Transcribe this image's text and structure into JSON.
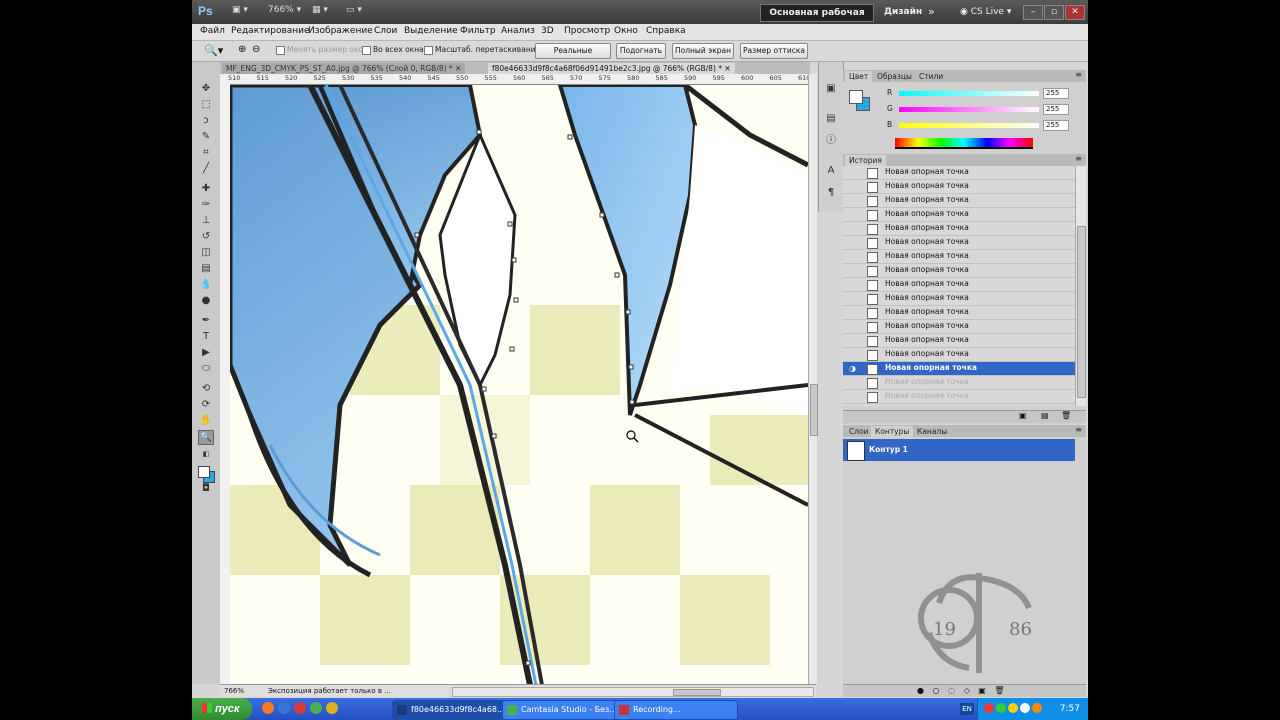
{
  "appbar": {
    "logo": "Ps",
    "zoom": "766%",
    "workspace_button": "Основная рабочая среда",
    "workspace_design": "Дизайн",
    "workspace_more": "»",
    "cslive": "CS Live"
  },
  "menu": [
    "Файл",
    "Редактирование",
    "Изображение",
    "Слои",
    "Выделение",
    "Фильтр",
    "Анализ",
    "3D",
    "Просмотр",
    "Окно",
    "Справка"
  ],
  "options": {
    "resize_windows": "Менять размер окон",
    "all_windows": "Во всех окнах",
    "scrubby_zoom": "Масштаб. перетаскиванием",
    "actual_pixels": "Реальные пикселы",
    "fit_screen": "Подогнать",
    "fill_screen": "Полный экран",
    "print_size": "Размер оттиска"
  },
  "document": {
    "tab_inactive": "MF_ENG_3D_CMYK_PS_ST_A0.jpg @ 766% (Слой 0, RGB/8) *",
    "tab_active": "f80e46633d9f8c4a68f06d91491be2c3.jpg @ 766% (RGB/8) *",
    "ruler_ticks": [
      "510",
      "515",
      "520",
      "525",
      "530",
      "535",
      "540",
      "545",
      "550",
      "555",
      "560",
      "565",
      "570",
      "575",
      "580",
      "585",
      "590",
      "595",
      "600",
      "605",
      "610"
    ],
    "status_zoom": "766%",
    "status_info": "Экспозиция работает только в ..."
  },
  "color_panel": {
    "tabs": [
      "Цвет",
      "Образцы",
      "Стили"
    ],
    "channels": [
      {
        "label": "R",
        "value": "255",
        "gradient": "#00ffff"
      },
      {
        "label": "G",
        "value": "255",
        "gradient": "#ff00ff"
      },
      {
        "label": "B",
        "value": "255",
        "gradient": "#ffff00"
      }
    ]
  },
  "history_panel": {
    "title": "История",
    "items": [
      {
        "label": "Новая опорная точка",
        "state": "normal"
      },
      {
        "label": "Новая опорная точка",
        "state": "normal"
      },
      {
        "label": "Новая опорная точка",
        "state": "normal"
      },
      {
        "label": "Новая опорная точка",
        "state": "normal"
      },
      {
        "label": "Новая опорная точка",
        "state": "normal"
      },
      {
        "label": "Новая опорная точка",
        "state": "normal"
      },
      {
        "label": "Новая опорная точка",
        "state": "normal"
      },
      {
        "label": "Новая опорная точка",
        "state": "normal"
      },
      {
        "label": "Новая опорная точка",
        "state": "normal"
      },
      {
        "label": "Новая опорная точка",
        "state": "normal"
      },
      {
        "label": "Новая опорная точка",
        "state": "normal"
      },
      {
        "label": "Новая опорная точка",
        "state": "normal"
      },
      {
        "label": "Новая опорная точка",
        "state": "normal"
      },
      {
        "label": "Новая опорная точка",
        "state": "normal"
      },
      {
        "label": "Новая опорная точка",
        "state": "selected"
      },
      {
        "label": "Новая опорная точка",
        "state": "future"
      },
      {
        "label": "Новая опорная точка",
        "state": "future"
      }
    ]
  },
  "paths_panel": {
    "tabs": [
      "Слои",
      "Контуры",
      "Каналы"
    ],
    "path_name": "Контур 1"
  },
  "taskbar": {
    "start": "пуск",
    "tasks": [
      "f80e46633d9f8c4a68...",
      "Camtasia Studio - Без...",
      "Recording..."
    ],
    "clock": "7:57",
    "lang": "EN"
  },
  "watermark": {
    "text_left": "19",
    "text_right": "86"
  }
}
